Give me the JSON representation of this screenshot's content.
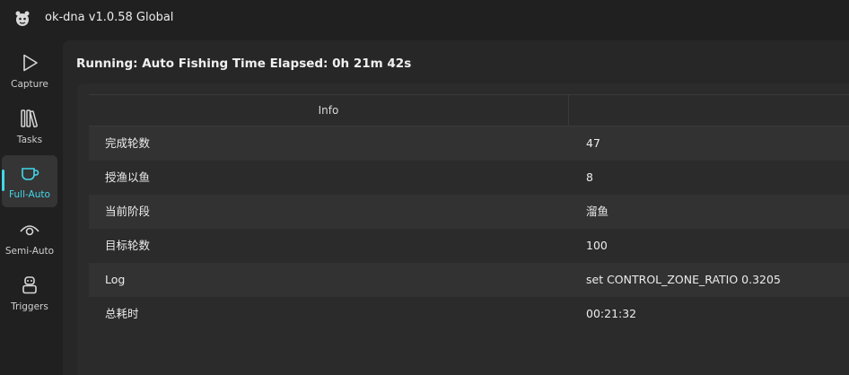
{
  "window": {
    "title": "ok-dna v1.0.58 Global"
  },
  "sidebar": {
    "items": [
      {
        "label": "Capture",
        "icon": "play-icon"
      },
      {
        "label": "Tasks",
        "icon": "library-icon"
      },
      {
        "label": "Full-Auto",
        "icon": "cup-icon",
        "active": true
      },
      {
        "label": "Semi-Auto",
        "icon": "eye-icon"
      },
      {
        "label": "Triggers",
        "icon": "robot-icon"
      }
    ]
  },
  "status": {
    "text": "Running: Auto Fishing Time Elapsed: 0h 21m 42s"
  },
  "table": {
    "headers": [
      "Info",
      ""
    ],
    "rows": [
      {
        "key": "完成轮数",
        "value": "47"
      },
      {
        "key": "授渔以鱼",
        "value": "8"
      },
      {
        "key": "当前阶段",
        "value": "溜鱼"
      },
      {
        "key": "目标轮数",
        "value": "100"
      },
      {
        "key": "Log",
        "value": "set CONTROL_ZONE_RATIO 0.3205"
      },
      {
        "key": "总耗时",
        "value": "00:21:32"
      }
    ]
  },
  "colors": {
    "accent": "#43d6e9",
    "background": "#202020",
    "panel": "#272727"
  }
}
